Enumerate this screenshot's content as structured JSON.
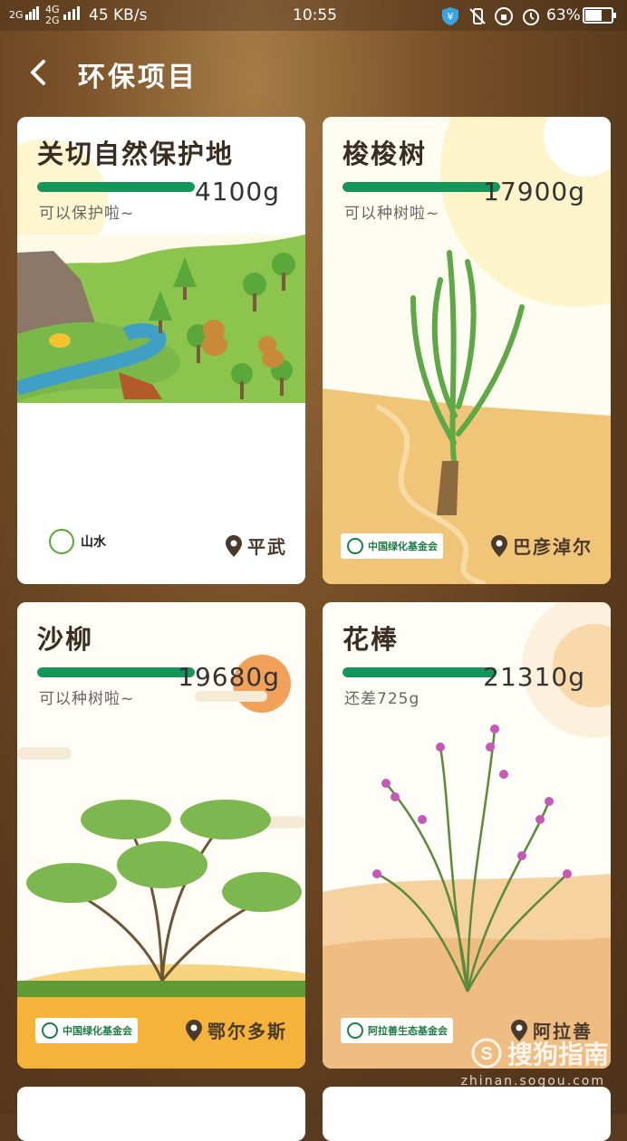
{
  "status_bar": {
    "signal": "2G",
    "network": "4G",
    "network2": "2G",
    "speed": "45 KB/s",
    "time": "10:55",
    "battery": "63%"
  },
  "header": {
    "title": "环保项目"
  },
  "cards": [
    {
      "name": "关切自然保护地",
      "weight": "4100g",
      "note": "可以保护啦~",
      "location": "平武",
      "progress": 1.0,
      "logo_text": "山水"
    },
    {
      "name": "梭梭树",
      "weight": "17900g",
      "note": "可以种树啦~",
      "location": "巴彦淖尔",
      "progress": 1.0,
      "logo_text": "中国绿化基金会"
    },
    {
      "name": "沙柳",
      "weight": "19680g",
      "note": "可以种树啦~",
      "location": "鄂尔多斯",
      "progress": 1.0,
      "logo_text": "中国绿化基金会"
    },
    {
      "name": "花棒",
      "weight": "21310g",
      "note": "还差725g",
      "location": "阿拉善",
      "progress": 0.97,
      "logo_text": "阿拉善生态基金会"
    }
  ],
  "watermark": {
    "brand": "搜狗指南",
    "url": "zhinan.sogou.com"
  },
  "colors": {
    "progress": "#14955a",
    "background": "#5a3b1f"
  }
}
